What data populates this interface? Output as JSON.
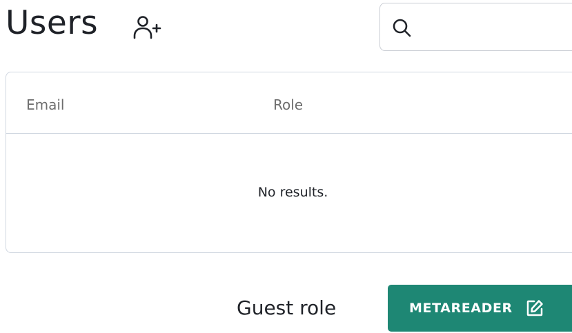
{
  "page": {
    "title": "Users"
  },
  "header": {
    "add_user_icon": "user-plus-icon",
    "search": {
      "icon": "search-icon",
      "value": "",
      "placeholder": ""
    }
  },
  "table": {
    "columns": [
      "Email",
      "Role"
    ],
    "rows": [],
    "empty_message": "No results."
  },
  "guest_role": {
    "label": "Guest role",
    "button_label": "METAREADER",
    "button_icon": "edit-icon"
  },
  "colors": {
    "accent": "#1e8774",
    "border": "#cfd6e0",
    "header_text": "#6d6d6d",
    "text": "#1f2228"
  }
}
